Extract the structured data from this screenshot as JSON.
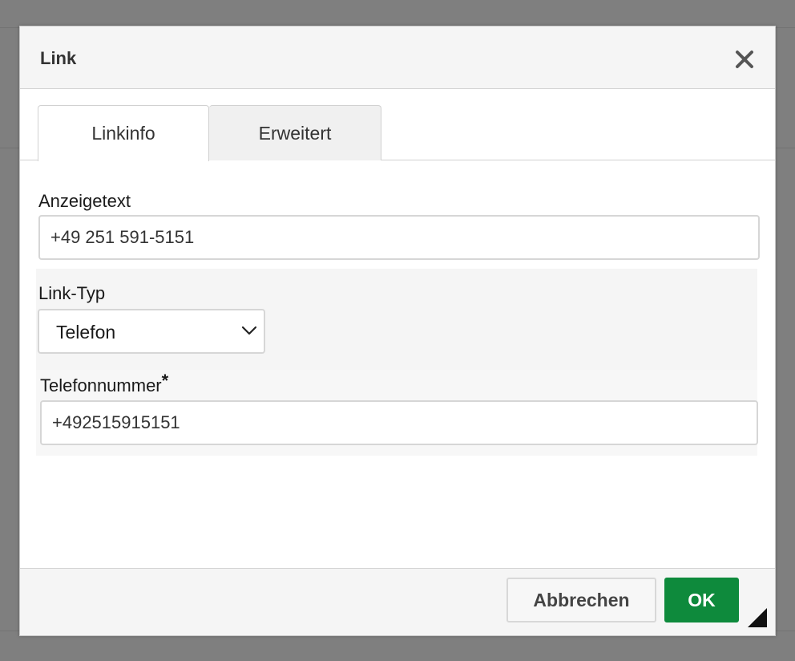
{
  "dialog": {
    "title": "Link",
    "close_icon": "close-icon"
  },
  "tabs": [
    {
      "label": "Linkinfo",
      "active": true
    },
    {
      "label": "Erweitert",
      "active": false
    }
  ],
  "display_text": {
    "label": "Anzeigetext",
    "value": "+49 251 591-5151"
  },
  "link_type": {
    "label": "Link-Typ",
    "selected": "Telefon",
    "icon": "chevron-down-icon"
  },
  "phone_number": {
    "label": "Telefonnummer",
    "required_marker": "*",
    "value": "+492515915151"
  },
  "footer": {
    "cancel_label": "Abbrechen",
    "ok_label": "OK",
    "resize_icon": "resize-handle-icon"
  },
  "colors": {
    "primary_button": "#0e8a3c",
    "overlay": "#7f7f7f",
    "header_bg": "#f5f5f5"
  }
}
